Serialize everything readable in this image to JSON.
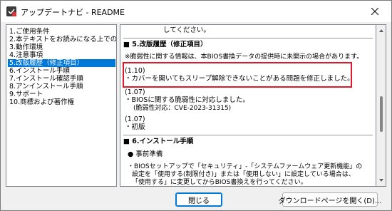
{
  "window": {
    "title": "アップデートナビ - README"
  },
  "toc": {
    "items": [
      {
        "label": "1.ご使用条件",
        "selected": false
      },
      {
        "label": "2.本テキストをお読みになる上での",
        "selected": false
      },
      {
        "label": "3.動作環境",
        "selected": false
      },
      {
        "label": "4.注意事項",
        "selected": false
      },
      {
        "label": "5.改版履歴（修正項目）",
        "selected": true
      },
      {
        "label": "6.インストール手順",
        "selected": false
      },
      {
        "label": "7.インストール確認手順",
        "selected": false
      },
      {
        "label": "8.アンインストール手順",
        "selected": false
      },
      {
        "label": "9.サポート",
        "selected": false
      },
      {
        "label": "10.商標および著作権",
        "selected": false
      }
    ]
  },
  "content": {
    "top_line": "してください。",
    "section5_heading": "■ 5.改版履歴（修正項目）",
    "vuln_note": "※脆弱性に関する情報は、本BIOS書換データの提供時に未開示の場合があります。",
    "v110_label": "(1.10)",
    "v110_text": "・カバーを開いてもスリープ解除できないことがある問題を修正しました。",
    "v107_label": "(1.07)",
    "v107_text1": "・BIOSに関する脆弱性に対応しました。",
    "v107_text2": "(脆弱性対応：CVE-2023-31315)",
    "v107b_label": "(1.07)",
    "v107b_text": "・初版",
    "section6_heading": "■ 6.インストール手順",
    "prep_heading": "● 事前準備",
    "prep_line1": "・BIOSセットアップで「セキュリティ」-「システムファームウェア更新機能」の",
    "prep_line2": "設定を「使用する(制限付き)」または「使用しない」に設定している場合は、",
    "prep_line3": "「使用する」に変更してからBIOS書換えを行ってください。"
  },
  "footer": {
    "close_label": "閉じる",
    "download_label": "ダウンロードページを開く(D)..."
  },
  "colors": {
    "highlight_border": "#e0192a",
    "selection_bg": "#0078d7"
  }
}
